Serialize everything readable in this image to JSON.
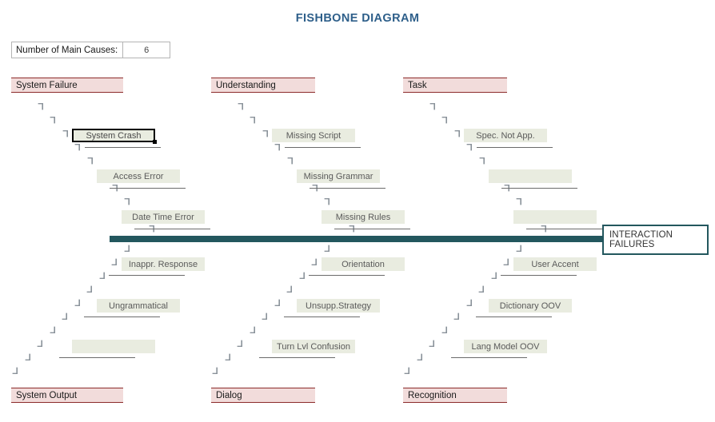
{
  "title": "FISHBONE DIAGRAM",
  "controls": {
    "main_causes_label": "Number of Main Causes:",
    "main_causes_value": "6"
  },
  "head": {
    "label": "INTERACTION FAILURES"
  },
  "colors": {
    "title": "#2e5f8a",
    "spine": "#23575e",
    "category_fill": "#f2dcdb",
    "category_border": "#8c2b2b",
    "subcause_fill": "#e9ece0",
    "subcause_text": "#5a5a5a",
    "head_border": "#23575e",
    "selection": "#000000"
  },
  "columns": [
    {
      "top_header": "System Failure",
      "bottom_header": "System Output",
      "top_causes": [
        "System Crash",
        "Access Error",
        "Date Time Error"
      ],
      "bottom_causes": [
        "Inappr. Response",
        "Ungrammatical",
        ""
      ]
    },
    {
      "top_header": "Understanding",
      "bottom_header": "Dialog",
      "top_causes": [
        "Missing Script",
        "Missing Grammar",
        "Missing Rules"
      ],
      "bottom_causes": [
        "Orientation",
        "Unsupp.Strategy",
        "Turn Lvl Confusion"
      ]
    },
    {
      "top_header": "Task",
      "bottom_header": "Recognition",
      "top_causes": [
        "Spec. Not App.",
        "",
        ""
      ],
      "bottom_causes": [
        "User Accent",
        "Dictionary OOV",
        "Lang Model OOV"
      ]
    }
  ],
  "selected_cause": "System Crash"
}
